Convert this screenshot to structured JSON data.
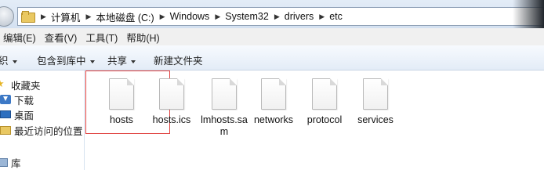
{
  "address": {
    "crumbs": [
      "计算机",
      "本地磁盘 (C:)",
      "Windows",
      "System32",
      "drivers",
      "etc"
    ]
  },
  "menu": [
    "编辑(E)",
    "查看(V)",
    "工具(T)",
    "帮助(H)"
  ],
  "toolbar": {
    "organize_label": "织",
    "include_library_label": "包含到库中",
    "share_label": "共享",
    "new_folder_label": "新建文件夹"
  },
  "nav": {
    "items": [
      {
        "label": "收藏夹",
        "icon": "star-icon"
      },
      {
        "label": "下载",
        "icon": "download-icon"
      },
      {
        "label": "桌面",
        "icon": "desktop-icon"
      },
      {
        "label": "最近访问的位置",
        "icon": "recent-places-icon"
      },
      {
        "label": "库",
        "icon": "library-icon"
      }
    ]
  },
  "files": [
    {
      "name": "hosts",
      "highlighted": true
    },
    {
      "name": "hosts.ics"
    },
    {
      "name": "lmhosts.sam"
    },
    {
      "name": "networks"
    },
    {
      "name": "protocol"
    },
    {
      "name": "services"
    }
  ],
  "colors": {
    "highlight": "#e0403e",
    "folder": "#e9c862",
    "toolbar_bg": "#e3ecf7"
  }
}
